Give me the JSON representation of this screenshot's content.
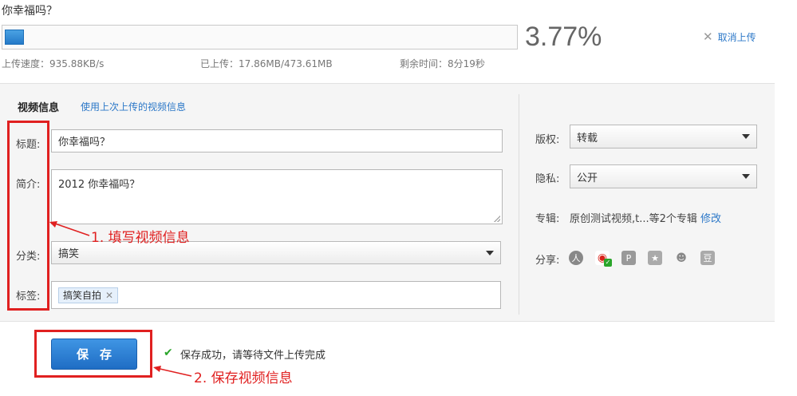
{
  "upload": {
    "file_name": "你幸福吗？",
    "progress": 0.0377,
    "percent_text": "3.77%",
    "cancel_label": "取消上传",
    "speed": "上传速度：935.88KB/s",
    "uploaded": "已上传：17.86MB/473.61MB",
    "remaining": "剩余时间：8分19秒"
  },
  "video_info": {
    "section_title": "视频信息",
    "use_last_link": "使用上次上传的视频信息",
    "title_label": "标题:",
    "title_value": "你幸福吗？",
    "intro_label": "简介:",
    "intro_value": "2012 你幸福吗？",
    "category_label": "分类:",
    "category_value": "搞笑",
    "tags_label": "标签:",
    "tags": [
      "搞笑自拍"
    ]
  },
  "settings": {
    "copyright_label": "版权:",
    "copyright_value": "转载",
    "privacy_label": "隐私:",
    "privacy_value": "公开",
    "album_label": "专辑:",
    "album_value": "原创测试视频,t...等2个专辑",
    "album_edit": "修改",
    "share_label": "分享:",
    "share_icons": [
      "renren-icon",
      "weibo-icon",
      "qzone-icon",
      "kaixin-icon",
      "people-icon",
      "douban-icon"
    ]
  },
  "actions": {
    "save_label": "保存",
    "save_message": "保存成功，请等待文件上传完成"
  },
  "annotations": {
    "step1": "1.  填写视频信息",
    "step2": "2.  保存视频信息",
    "color": "#e02020"
  },
  "colors": {
    "accent": "#2c78c8",
    "progress": "#2479c8",
    "panel": "#f5f5f5"
  }
}
